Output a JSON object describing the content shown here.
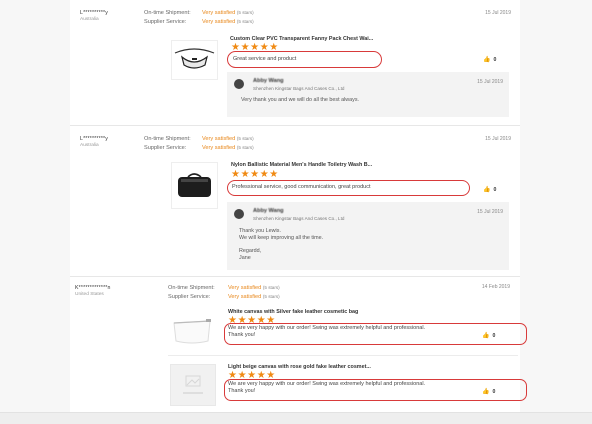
{
  "reviews": [
    {
      "reviewer": "L**********y",
      "country": "Australia",
      "shipment_label": "On-time Shipment:",
      "shipment_value": "Very satisfied",
      "shipment_stars": "(5 stars)",
      "service_label": "Supplier Service:",
      "service_value": "Very satisfied",
      "service_stars": "(5 stars)",
      "date": "15 Jul 2019",
      "product": "Custom Clear PVC Transparent Fanny Pack Chest Wai...",
      "stars": "★★★★★",
      "text": "Great service and product",
      "likes": "0",
      "reply": {
        "name": "Abby Wang",
        "company": "Shenzhen Kingstar Bags And Cases Co., Ltd",
        "date": "15 Jul 2019",
        "lines": [
          "Very thank you and we will do all the best always."
        ]
      }
    },
    {
      "reviewer": "L**********y",
      "country": "Australia",
      "shipment_label": "On-time Shipment:",
      "shipment_value": "Very satisfied",
      "shipment_stars": "(5 stars)",
      "service_label": "Supplier Service:",
      "service_value": "Very satisfied",
      "service_stars": "(5 stars)",
      "date": "15 Jul 2019",
      "product": "Nylon Ballistic Material Men's Handle Toiletry Wash B...",
      "stars": "★★★★★",
      "text": "Professional service, good communication, great product",
      "likes": "0",
      "reply": {
        "name": "Abby Wang",
        "company": "Shenzhen Kingstar Bags And Cases Co., Ltd",
        "date": "15 Jul 2019",
        "lines": [
          "Thank you Lewis.",
          "We will keep improving all the time.",
          "",
          "Regardd,",
          "Jane"
        ]
      }
    },
    {
      "reviewer": "K*************n",
      "country": "United States",
      "shipment_label": "On-time Shipment:",
      "shipment_value": "Very satisfied",
      "shipment_stars": "(5 stars)",
      "service_label": "Supplier Service:",
      "service_value": "Very satisfied",
      "service_stars": "(5 stars)",
      "date": "14 Feb 2019",
      "products": [
        {
          "name": "White canvas with Silver fake leather cosmetic bag",
          "stars": "★★★★★",
          "text_line1": "We are very happy with our order! Swing was extremely helpful and professional.",
          "text_line2": "Thank you!",
          "likes": "0"
        },
        {
          "name": "Light beige canvas with rose gold fake leather cosmet...",
          "stars": "★★★★★",
          "text_line1": "We are very happy with our order! Swing was extremely helpful and professional.",
          "text_line2": "Thank you!",
          "likes": "0"
        }
      ]
    }
  ],
  "icons": {
    "like": "thumbs-up-icon"
  }
}
